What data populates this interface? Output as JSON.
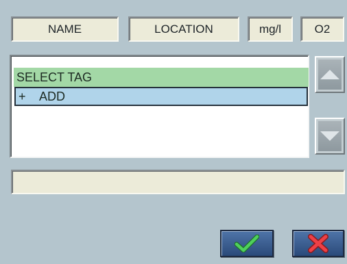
{
  "header": {
    "name_label": "NAME",
    "location_label": "LOCATION",
    "unit_label": "mg/l",
    "parameter_label": "O2"
  },
  "list": {
    "items": [
      {
        "label": "SELECT TAG",
        "highlight_color": "#a3d8a6"
      },
      {
        "prefix": "+",
        "label": "ADD",
        "highlight_color": "#b0d4ea",
        "selected": true
      }
    ]
  },
  "scrollbar": {
    "up_icon": "triangle-up-icon",
    "down_icon": "triangle-down-icon"
  },
  "status_field": {
    "value": ""
  },
  "actions": {
    "ok_icon": "check-icon",
    "ok_color": "#3cb84a",
    "cancel_icon": "x-icon",
    "cancel_color": "#e0383e"
  },
  "colors": {
    "background": "#b4c5cd",
    "label_field": "#ecebd9",
    "button_blue": "#3b5f92"
  }
}
